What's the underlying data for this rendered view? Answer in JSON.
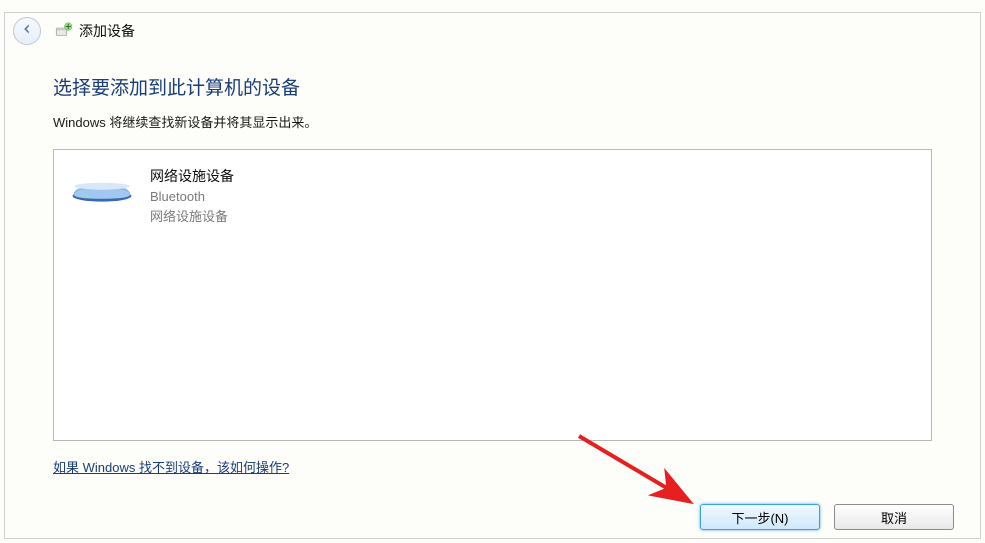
{
  "window": {
    "title": "添加设备"
  },
  "content": {
    "heading": "选择要添加到此计算机的设备",
    "subtext": "Windows 将继续查找新设备并将其显示出来。",
    "help_link": "如果 Windows 找不到设备，该如何操作?"
  },
  "devices": [
    {
      "name": "网络设施设备",
      "type": "Bluetooth",
      "category": "网络设施设备"
    }
  ],
  "buttons": {
    "next": "下一步(N)",
    "cancel": "取消"
  }
}
